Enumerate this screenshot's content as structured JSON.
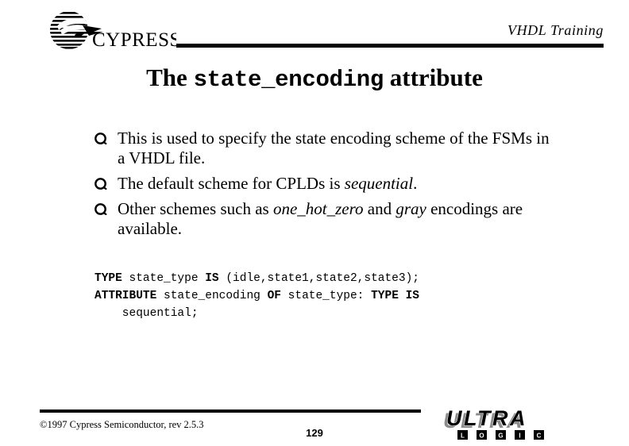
{
  "header": {
    "course_title": "VHDL Training",
    "logo_text": "CYPRESS",
    "logo_icon": "cypress-bird-logo"
  },
  "slide": {
    "title_prefix": "The ",
    "title_code": "state_encoding",
    "title_suffix": " attribute",
    "bullet_glyph": "wingdings-circle-bullet",
    "bullets": [
      {
        "segments": [
          {
            "text": "This is used to specify the state encoding scheme of the FSMs in a VHDL file.",
            "style": "normal"
          }
        ]
      },
      {
        "segments": [
          {
            "text": "The default scheme for CPLDs is ",
            "style": "normal"
          },
          {
            "text": "sequential",
            "style": "italic"
          },
          {
            "text": ".",
            "style": "normal"
          }
        ]
      },
      {
        "segments": [
          {
            "text": "Other schemes such as ",
            "style": "normal"
          },
          {
            "text": "one_hot_zero",
            "style": "italic"
          },
          {
            "text": " and ",
            "style": "normal"
          },
          {
            "text": "gray",
            "style": "italic"
          },
          {
            "text": " encodings are available.",
            "style": "normal"
          }
        ]
      }
    ],
    "code_lines": [
      {
        "tokens": [
          {
            "text": "TYPE",
            "style": "keyword"
          },
          {
            "text": " state_type ",
            "style": "plain"
          },
          {
            "text": "IS",
            "style": "keyword"
          },
          {
            "text": " (idle,state1,state2,state3);",
            "style": "plain"
          }
        ]
      },
      {
        "tokens": [
          {
            "text": "ATTRIBUTE",
            "style": "keyword"
          },
          {
            "text": " state_encoding ",
            "style": "plain"
          },
          {
            "text": "OF",
            "style": "keyword"
          },
          {
            "text": " state_type: ",
            "style": "plain"
          },
          {
            "text": "TYPE IS",
            "style": "keyword"
          }
        ]
      },
      {
        "tokens": [
          {
            "text": "    sequential;",
            "style": "plain"
          }
        ]
      }
    ]
  },
  "footer": {
    "copyright": "©1997 Cypress Semiconductor, rev 2.5.3",
    "page_number": "129",
    "brand_primary": "ULTRA",
    "brand_secondary": "LOGIC",
    "brand_secondary_letters": [
      "L",
      "O",
      "G",
      "I",
      "C"
    ],
    "brand_icon": "ultralogic-logo"
  },
  "colors": {
    "background": "#ffffff",
    "foreground": "#000000",
    "logo_shadow": "#8c8c8c"
  }
}
